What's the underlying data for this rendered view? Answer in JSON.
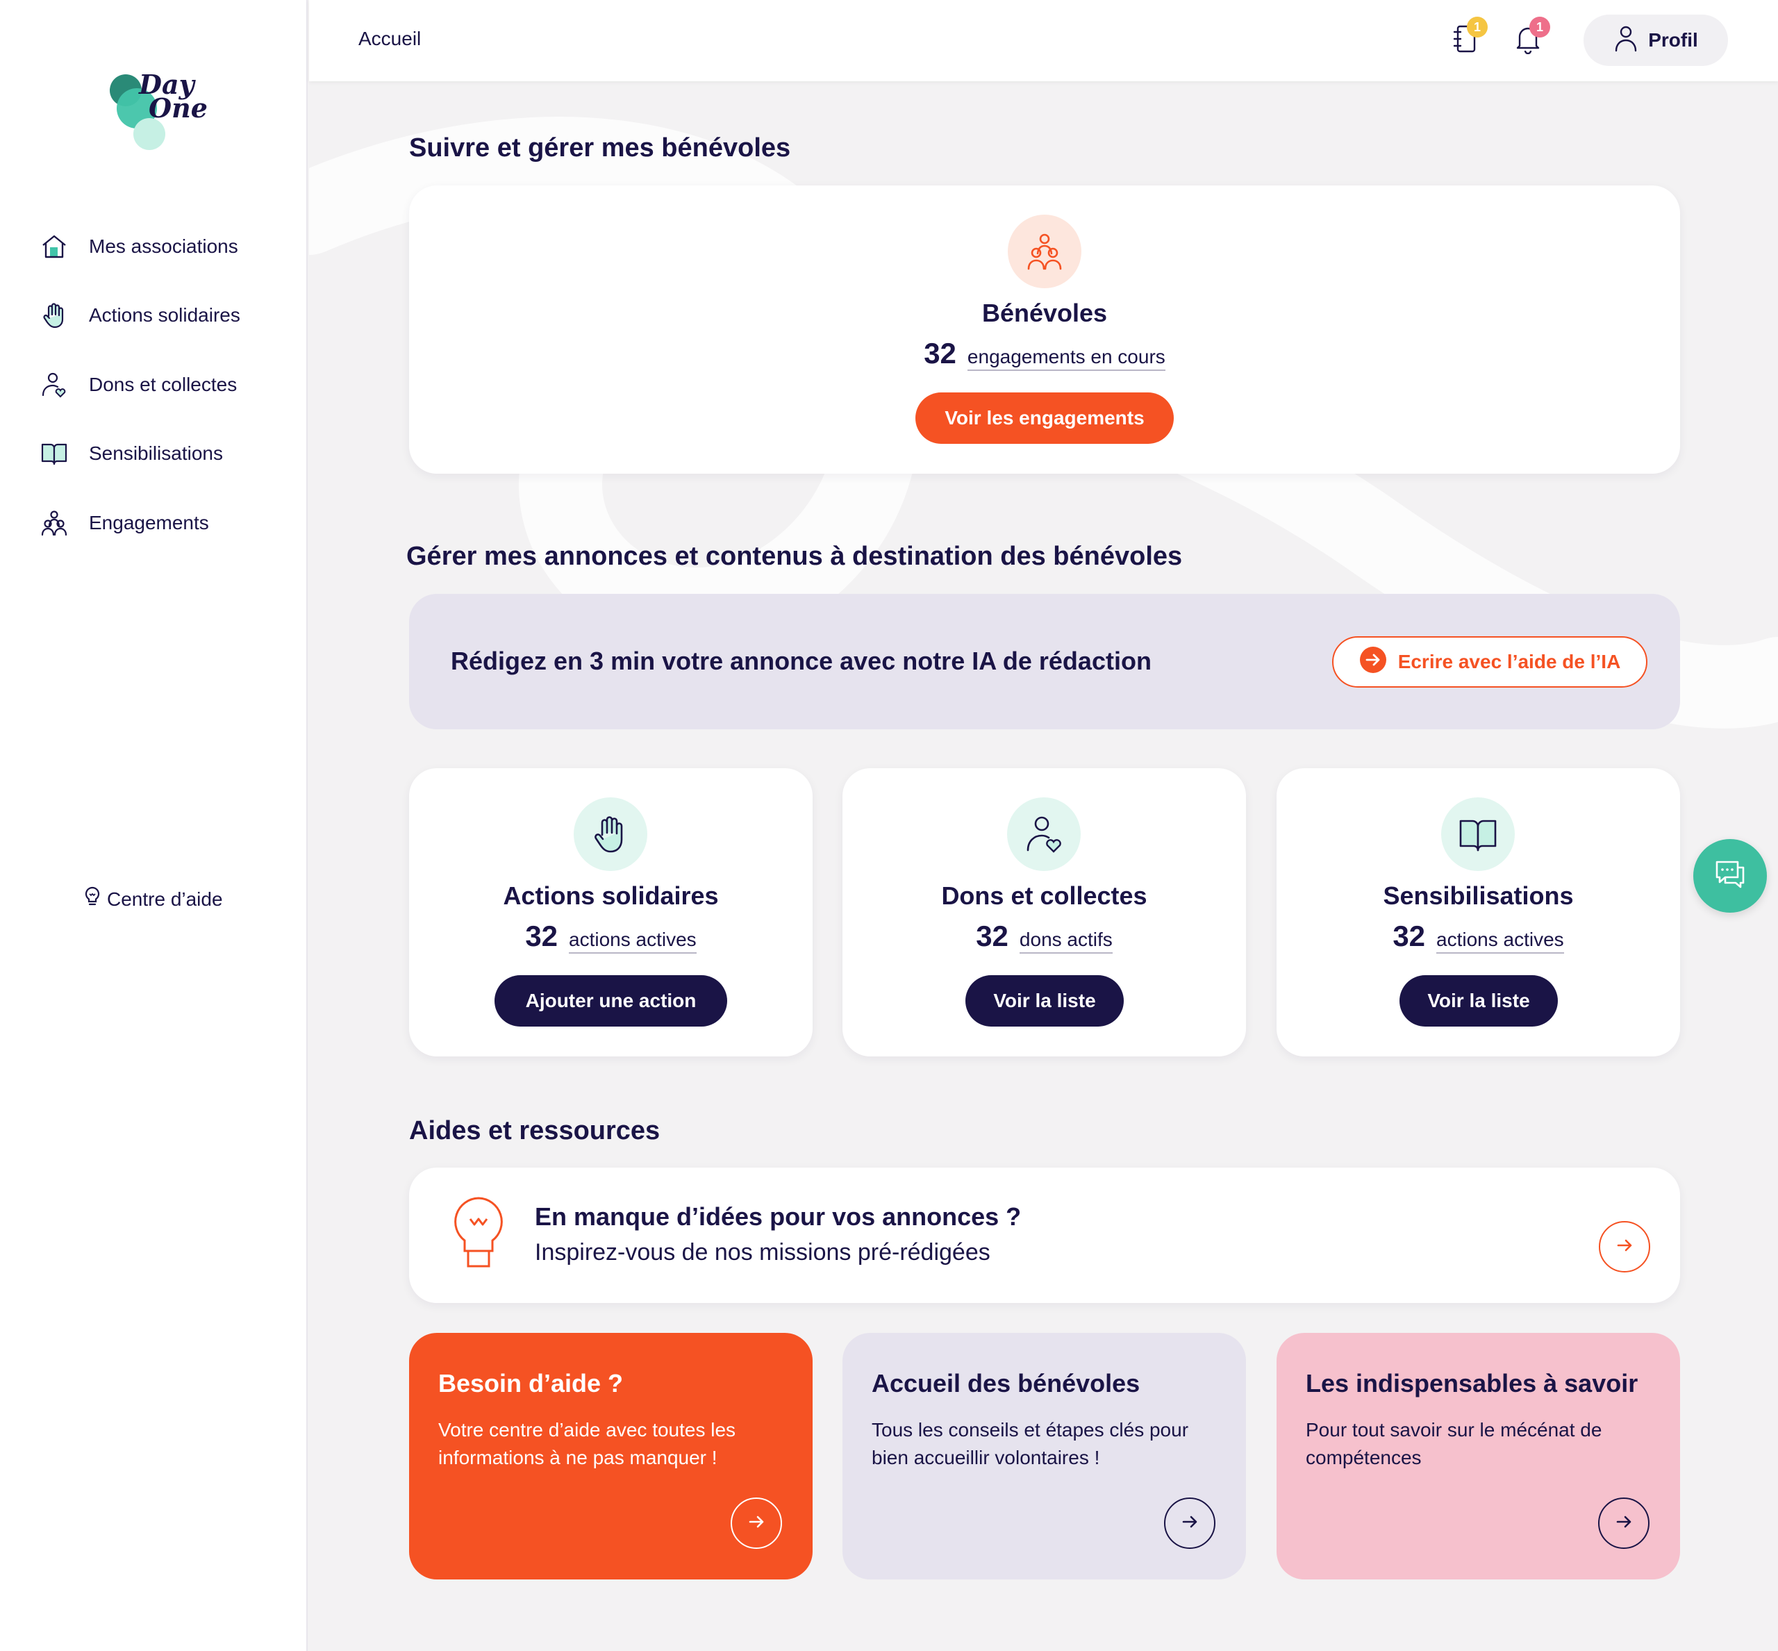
{
  "brand": {
    "logo_text_line1": "Day",
    "logo_text_line2": "One"
  },
  "sidebar": {
    "items": [
      {
        "label": "Mes associations",
        "icon": "home-icon"
      },
      {
        "label": "Actions solidaires",
        "icon": "hand-icon"
      },
      {
        "label": "Dons et collectes",
        "icon": "person-heart-icon"
      },
      {
        "label": "Sensibilisations",
        "icon": "book-icon"
      },
      {
        "label": "Engagements",
        "icon": "group-icon"
      }
    ],
    "help_label": "Centre d’aide"
  },
  "topbar": {
    "breadcrumb": "Accueil",
    "notebook_badge": "1",
    "bell_badge": "1",
    "profile_label": "Profil"
  },
  "section1": {
    "title": "Suivre et gérer mes bénévoles",
    "card": {
      "title": "Bénévoles",
      "count": "32",
      "count_label": "engagements en cours",
      "button": "Voir les engagements"
    }
  },
  "section2": {
    "title": "Gérer mes annonces et contenus à destination des bénévoles",
    "ai_banner": {
      "text": "Rédigez en 3 min votre annonce avec notre IA de rédaction",
      "button": "Ecrire avec l’aide de l’IA"
    },
    "cards": [
      {
        "title": "Actions solidaires",
        "count": "32",
        "count_label": "actions actives",
        "button": "Ajouter une action"
      },
      {
        "title": "Dons et collectes",
        "count": "32",
        "count_label": "dons actifs",
        "button": "Voir la liste"
      },
      {
        "title": "Sensibilisations",
        "count": "32",
        "count_label": "actions actives",
        "button": "Voir la liste"
      }
    ]
  },
  "section3": {
    "title": "Aides et ressources",
    "ideas": {
      "title": "En manque d’idées pour vos annonces ?",
      "subtitle": "Inspirez-vous de nos missions pré-rédigées"
    },
    "tiles": [
      {
        "title": "Besoin d’aide ?",
        "desc": "Votre centre d’aide avec toutes les informations à ne pas manquer !"
      },
      {
        "title": "Accueil des bénévoles",
        "desc": "Tous les conseils et étapes clés pour bien accueillir volontaires !"
      },
      {
        "title": "Les indispensables à savoir",
        "desc": "Pour tout savoir sur le mécénat de compétences"
      }
    ]
  },
  "colors": {
    "navy": "#1a1446",
    "orange": "#f55223",
    "teal": "#3ebfa0",
    "lavender": "#e6e3ee",
    "pink": "#f6c1cd"
  }
}
